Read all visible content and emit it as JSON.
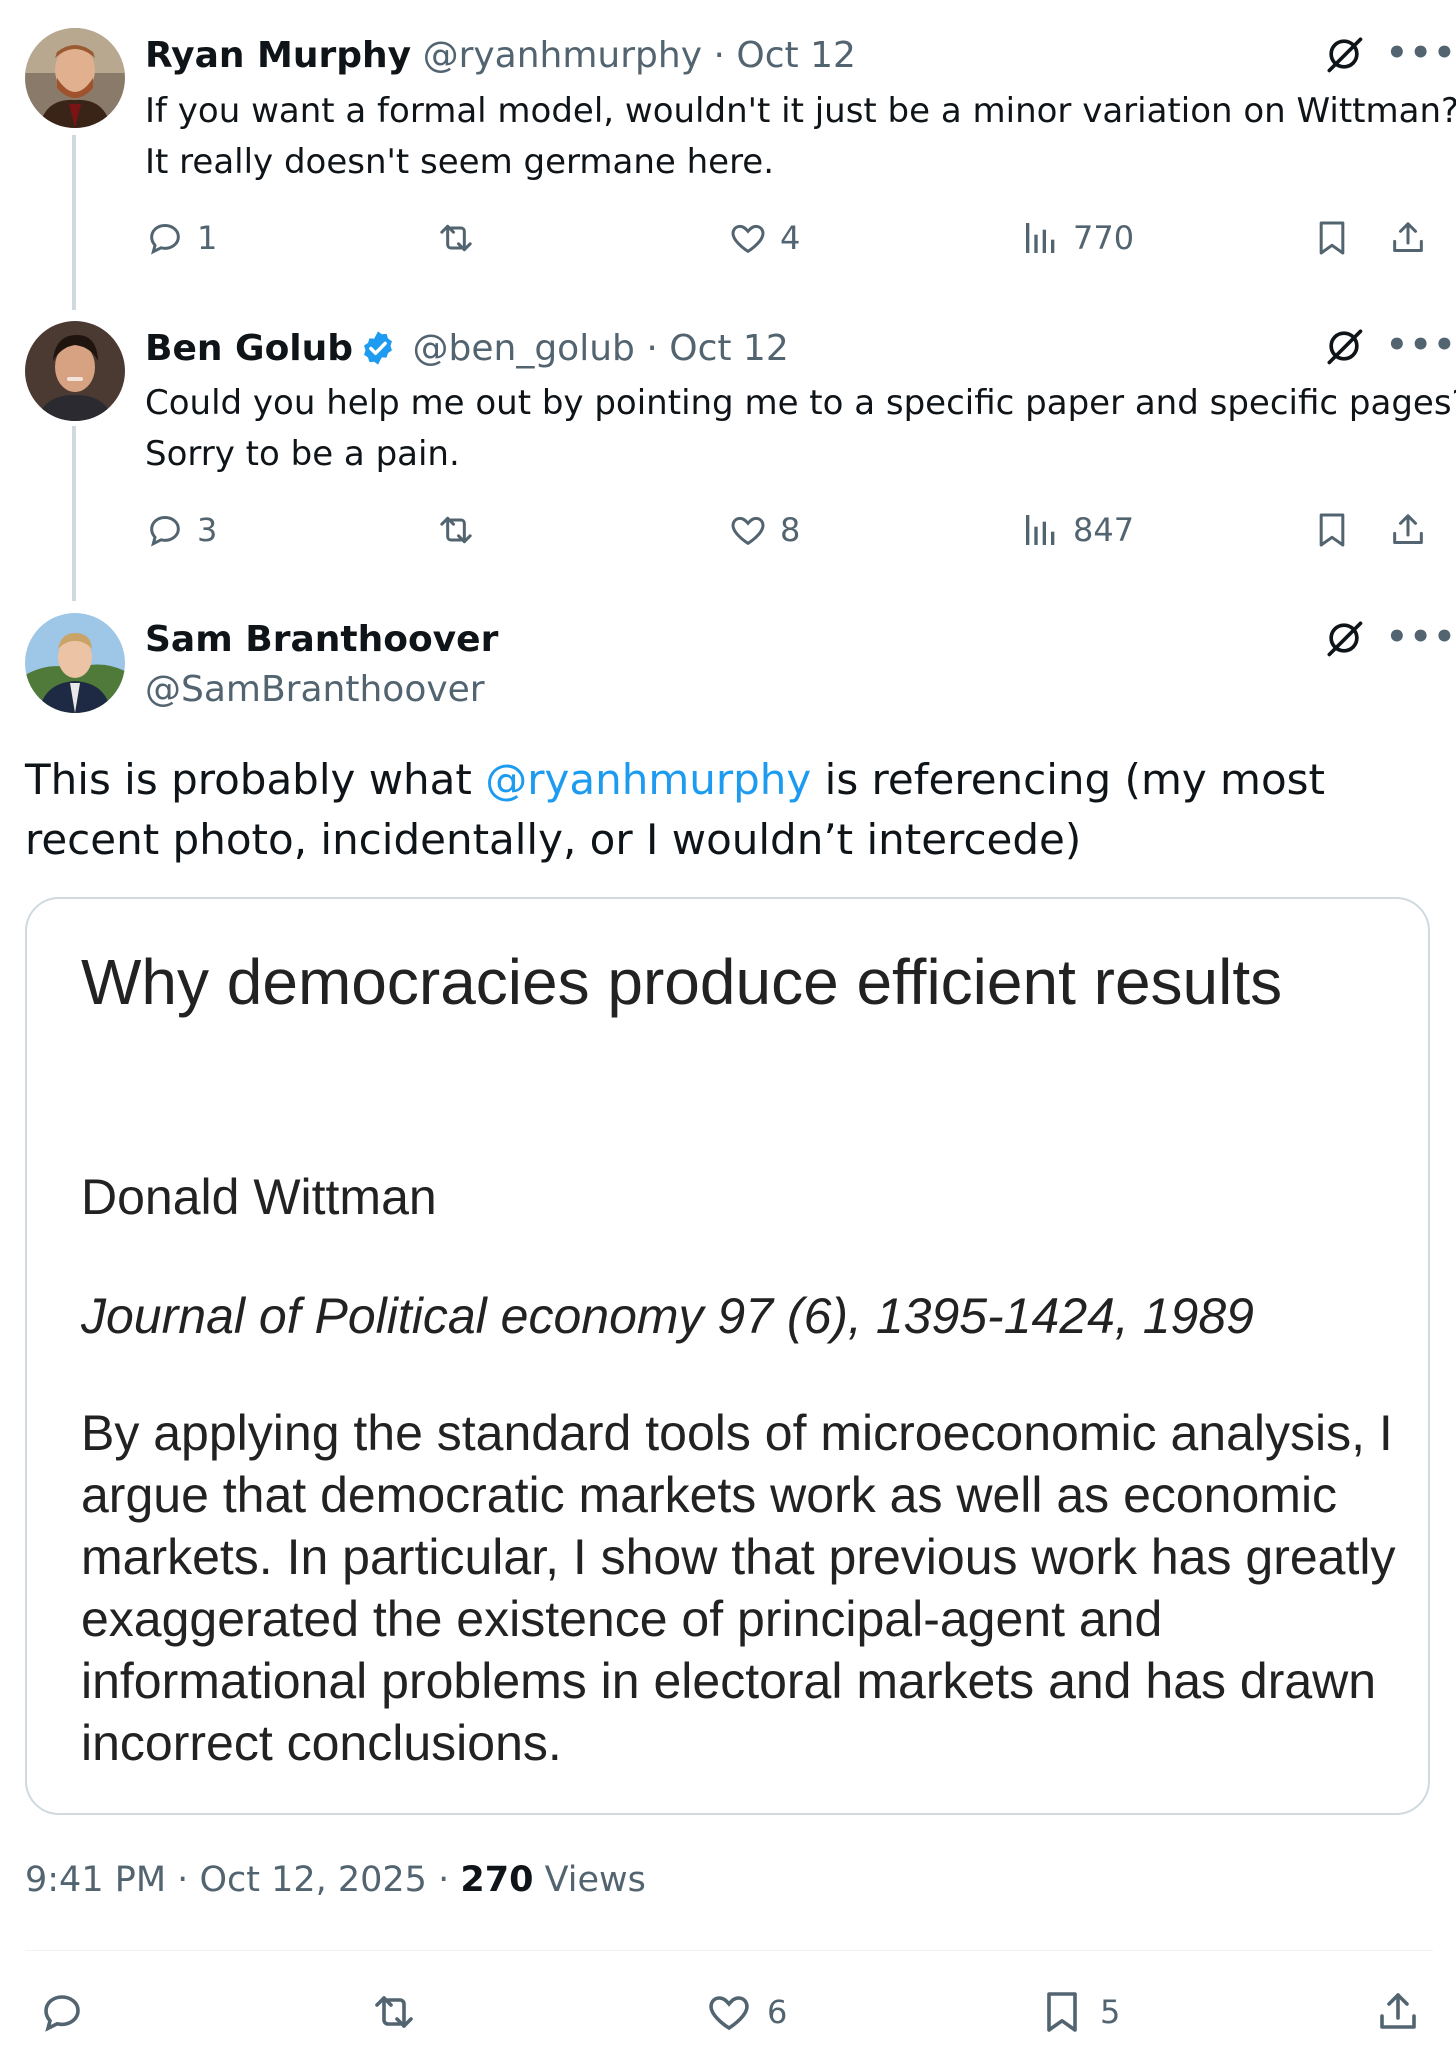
{
  "replies": [
    {
      "name": "Ryan Murphy",
      "handle": "@ryanhmurphy",
      "date": "Oct 12",
      "text_line1": "If you want a formal model, wouldn't it just be a minor variation on Wittman?",
      "text_line2": "It really doesn't seem germane here.",
      "replies": "1",
      "likes": "4",
      "views": "770"
    },
    {
      "name": "Ben Golub",
      "handle": "@ben_golub",
      "date": "Oct 12",
      "text_line1": "Could you help me out by pointing me to a specific paper and specific pages?",
      "text_line2": "Sorry to be a pain.",
      "replies": "3",
      "likes": "8",
      "views": "847"
    }
  ],
  "main": {
    "name": "Sam Branthoover",
    "handle": "@SamBranthoover",
    "text_before": "This is probably what ",
    "mention": "@ryanhmurphy",
    "text_after": " is referencing (my most recent photo, incidentally, or I wouldn’t intercede)",
    "card": {
      "title": "Why democracies produce efficient results",
      "author": "Donald Wittman",
      "journal": "Journal of Political economy 97 (6), 1395-1424, 1989",
      "abstract": "By applying the standard tools of microeconomic analysis, I argue that democratic markets work as well as economic markets. In particular, I show that previous work has greatly exaggerated the existence of principal-agent and informational problems in electoral markets and has drawn incorrect conclusions."
    },
    "time": "9:41 PM",
    "date": "Oct 12, 2025",
    "views_count": "270",
    "views_label": "Views",
    "likes": "6",
    "bookmarks": "5"
  },
  "colors": {
    "accent": "#1d9bf0",
    "text": "#0f1419",
    "secondary": "#536471"
  },
  "icons": [
    "grok-icon",
    "more-icon",
    "reply-icon",
    "retweet-icon",
    "like-icon",
    "views-icon",
    "bookmark-icon",
    "share-icon",
    "verified-badge-icon"
  ]
}
